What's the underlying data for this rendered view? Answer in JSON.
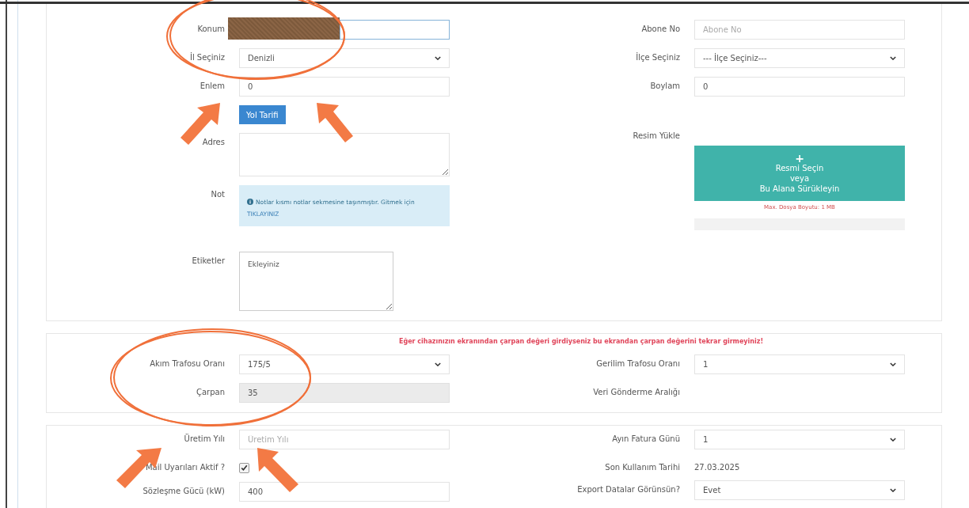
{
  "panels": [
    {
      "left": [
        {
          "label": "Konum",
          "kind": "input",
          "focused": true,
          "redacted": true
        },
        {
          "label": "İl Seçiniz",
          "kind": "select",
          "value": "Denizli"
        },
        {
          "label": "Enlem",
          "kind": "input",
          "value": "0"
        },
        {
          "kind": "button",
          "value": "Yol Tarifi"
        },
        {
          "label": "Adres",
          "kind": "textarea"
        },
        {
          "label": "Not",
          "kind": "info",
          "value": "Notlar kısmı notlar sekmesine taşınmıştır. Gitmek için",
          "link": "TIKLAYINIZ"
        },
        {
          "label": "Etiketler",
          "kind": "tag_box",
          "placeholder": "Ekleyiniz"
        }
      ],
      "right": [
        {
          "label": "Abone No",
          "kind": "input",
          "placeholder": "Abone No"
        },
        {
          "label": "İlçe Seçiniz",
          "kind": "select",
          "value": "--- İlçe Seçiniz---"
        },
        {
          "label": "Boylam",
          "kind": "input",
          "value": "0"
        },
        {
          "label": "Resim Yükle",
          "kind": "upload",
          "icon": "+",
          "lines": [
            "Resmi Seçin",
            "veya",
            "Bu Alana Sürükleyin"
          ],
          "note": "Max. Dosya Boyutu: 1 MB"
        }
      ]
    },
    {
      "warning": "Eğer cihazınızın ekranından çarpan değeri girdiyseniz bu ekrandan çarpan değerini tekrar girmeyiniz!",
      "left": [
        {
          "label": "Akım Trafosu Oranı",
          "kind": "select",
          "value": "175/5"
        },
        {
          "label": "Çarpan",
          "kind": "readonly",
          "value": "35"
        }
      ],
      "right": [
        {
          "label": "Gerilim Trafosu Oranı",
          "kind": "select",
          "value": "1"
        },
        {
          "label": "Veri Gönderme Aralığı",
          "kind": "none"
        }
      ]
    },
    {
      "left": [
        {
          "label": "Üretim Yılı",
          "kind": "input",
          "placeholder": "Üretim Yılı"
        },
        {
          "label": "Mail Uyarıları Aktif ?",
          "kind": "checkbox",
          "checked": true
        },
        {
          "label": "Sözleşme Gücü (kW)",
          "kind": "input",
          "value": "400"
        }
      ],
      "right": [
        {
          "label": "Ayın Fatura Günü",
          "kind": "select",
          "value": "1"
        },
        {
          "label": "Son Kullanım Tarihi",
          "kind": "text",
          "value": "27.03.2025"
        },
        {
          "label": "Export Datalar Görünsün?",
          "kind": "select",
          "value": "Evet"
        }
      ]
    }
  ]
}
